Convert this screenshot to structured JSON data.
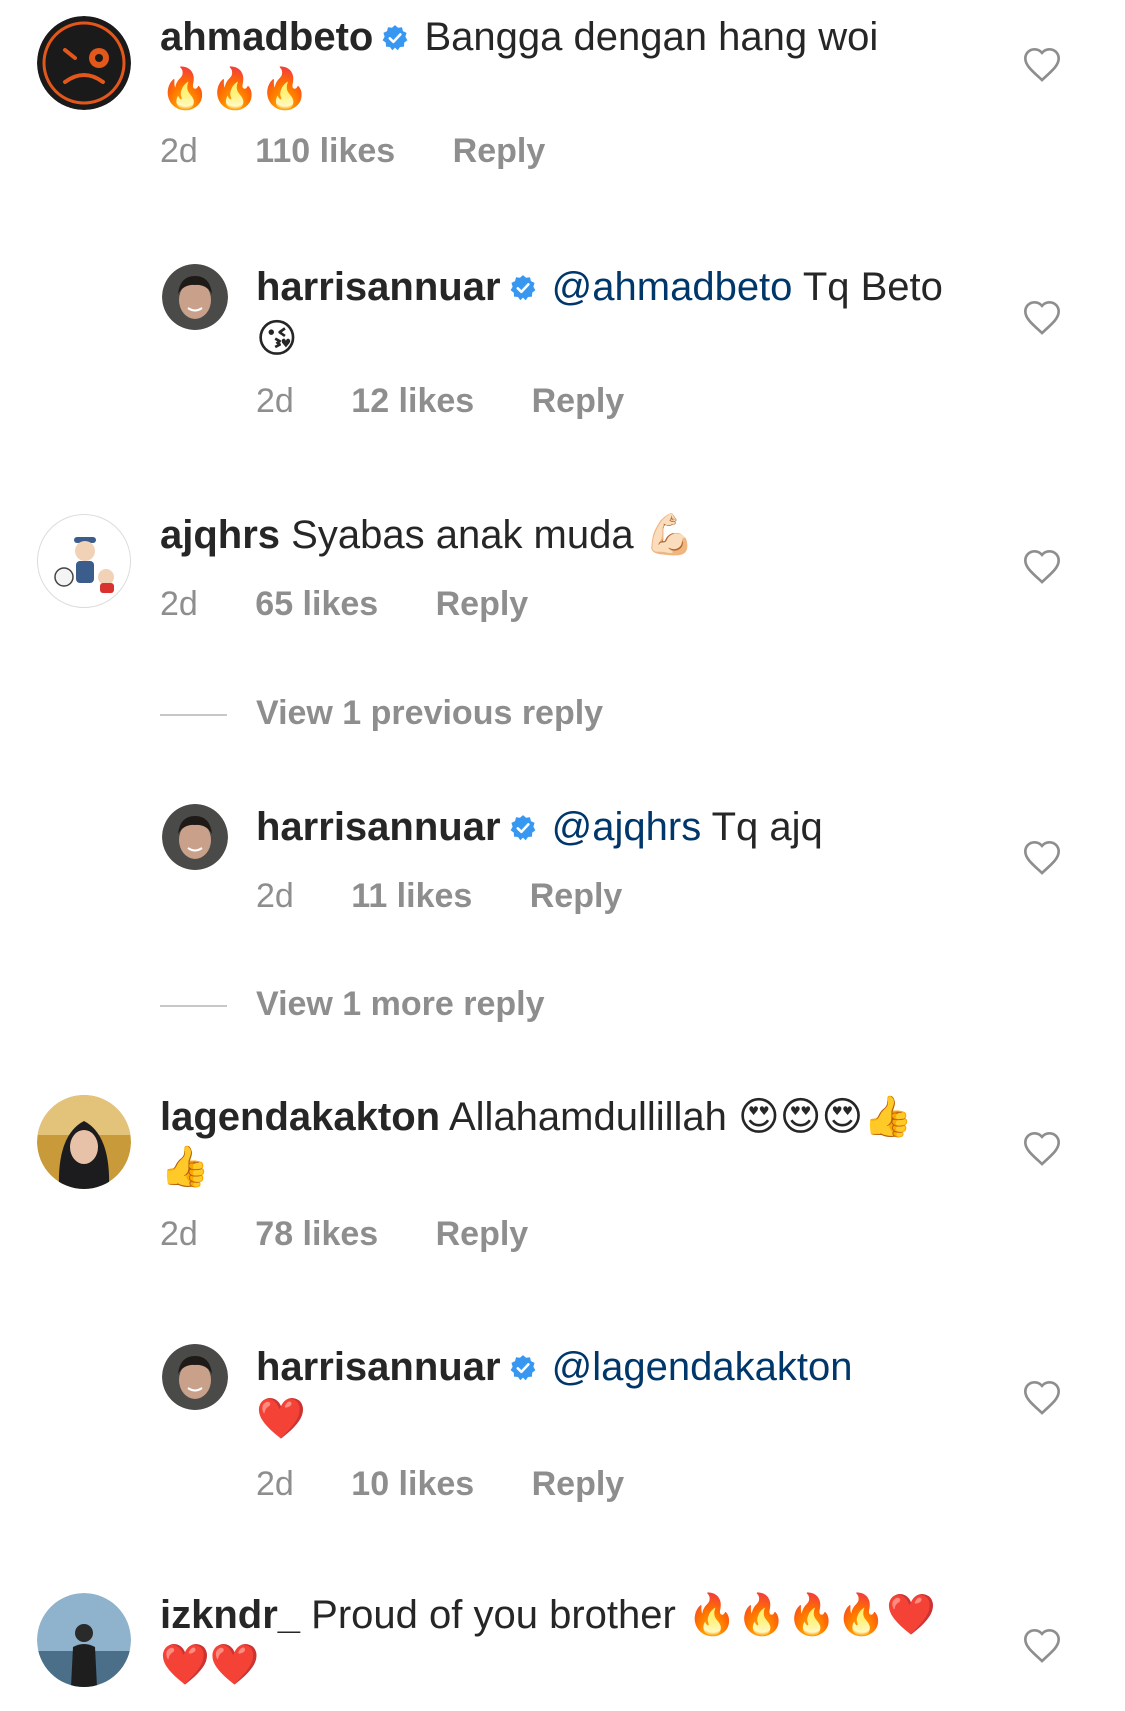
{
  "colors": {
    "text": "#262626",
    "secondary": "#8e8e8e",
    "mention": "#00376b",
    "verified": "#3897f0"
  },
  "comments": [
    {
      "username": "ahmadbeto",
      "text": "Bangga dengan hang woi",
      "emojis": "🔥🔥🔥",
      "time": "2d",
      "likes": "110 likes",
      "reply": "Reply"
    },
    {
      "username": "harrisannuar",
      "mention": "@ahmadbeto",
      "text": "Tq Beto",
      "emojis": "😘",
      "time": "2d",
      "likes": "12 likes",
      "reply": "Reply"
    },
    {
      "username": "ajqhrs",
      "text": "Syabas anak muda",
      "emojis": "💪🏻",
      "time": "2d",
      "likes": "65 likes",
      "reply": "Reply"
    },
    {
      "username": "harrisannuar",
      "mention": "@ajqhrs",
      "text": "Tq ajq",
      "emojis": "",
      "time": "2d",
      "likes": "11 likes",
      "reply": "Reply"
    },
    {
      "username": "lagendakakton",
      "text": "Allahamdullillah",
      "emojis": "😍😍😍👍👍",
      "time": "2d",
      "likes": "78 likes",
      "reply": "Reply"
    },
    {
      "username": "harrisannuar",
      "mention": "@lagendakakton",
      "text": "",
      "emojis": "❤️",
      "time": "2d",
      "likes": "10 likes",
      "reply": "Reply"
    },
    {
      "username": "izkndr_",
      "text": "Proud of you brother",
      "emojis": "🔥🔥🔥🔥❤️❤️❤️"
    }
  ],
  "view_links": {
    "previous": "View 1 previous reply",
    "more": "View 1 more reply"
  }
}
